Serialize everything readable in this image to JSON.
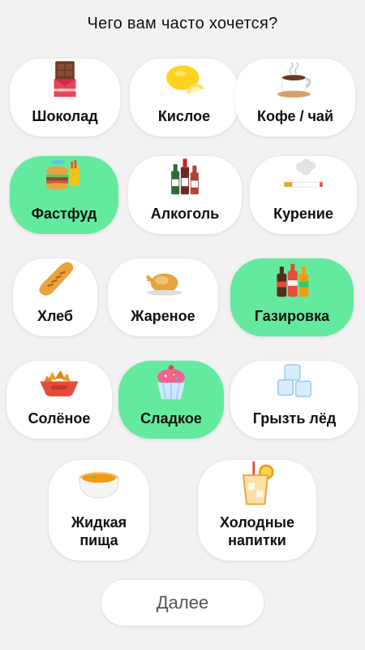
{
  "header": {
    "title": "Чего вам часто хочется?"
  },
  "options": [
    {
      "label": "Шоколад",
      "icon": "chocolate-icon",
      "selected": false
    },
    {
      "label": "Кислое",
      "icon": "lemon-icon",
      "selected": false
    },
    {
      "label": "Кофе / чай",
      "icon": "coffee-cup-icon",
      "selected": false
    },
    {
      "label": "Фастфуд",
      "icon": "fastfood-icon",
      "selected": true
    },
    {
      "label": "Алкоголь",
      "icon": "alcohol-bottles-icon",
      "selected": false
    },
    {
      "label": "Курение",
      "icon": "cigarette-icon",
      "selected": false
    },
    {
      "label": "Хлеб",
      "icon": "bread-icon",
      "selected": false
    },
    {
      "label": "Жареное",
      "icon": "roast-chicken-icon",
      "selected": false
    },
    {
      "label": "Газировка",
      "icon": "soda-bottles-icon",
      "selected": true
    },
    {
      "label": "Солёное",
      "icon": "chips-bowl-icon",
      "selected": false
    },
    {
      "label": "Сладкое",
      "icon": "cupcake-icon",
      "selected": true
    },
    {
      "label": "Грызть лёд",
      "icon": "ice-cubes-icon",
      "selected": false
    },
    {
      "label": "Жидкая\nпища",
      "icon": "soup-bowl-icon",
      "selected": false
    },
    {
      "label": "Холодные\nнапитки",
      "icon": "cold-drink-icon",
      "selected": false
    }
  ],
  "footer": {
    "next_label": "Далее"
  },
  "colors": {
    "selected": "#64ea9f",
    "card": "#ffffff",
    "background": "#f2f2f2"
  }
}
